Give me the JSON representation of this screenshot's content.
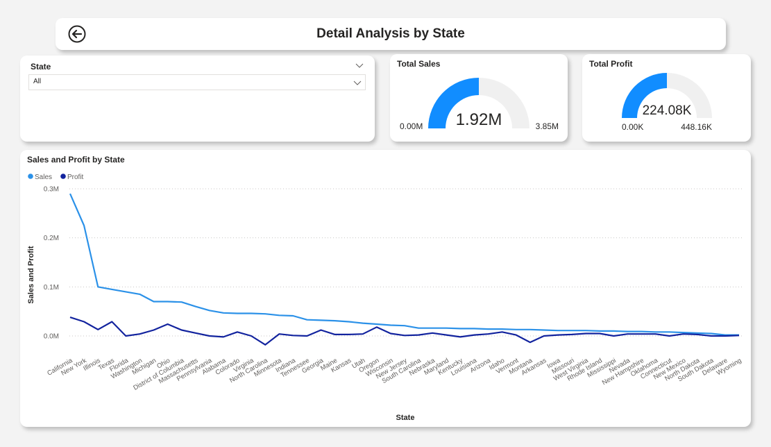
{
  "header": {
    "title": "Detail Analysis by State",
    "back_icon": "back-arrow-icon"
  },
  "slicer": {
    "label": "State",
    "selected": "All"
  },
  "kpis": {
    "sales": {
      "label": "Total Sales",
      "value": "1.92M",
      "min": "0.00M",
      "max": "3.85M",
      "fraction": 0.5,
      "color": "#118DFF"
    },
    "profit": {
      "label": "Total Profit",
      "value": "224.08K",
      "min": "0.00K",
      "max": "448.16K",
      "fraction": 0.5,
      "color": "#118DFF"
    }
  },
  "colors": {
    "sales": "#2B91E8",
    "profit": "#12239E",
    "gauge_track": "#F0F0F0"
  },
  "chart": {
    "title": "Sales and Profit by State"
  },
  "chart_data": {
    "type": "line",
    "title": "Sales and Profit by State",
    "xlabel": "State",
    "ylabel": "Sales and Profit",
    "ylim": [
      -0.02,
      0.3
    ],
    "yticks": [
      0,
      0.1,
      0.2,
      0.3
    ],
    "ytick_labels": [
      "0.0M",
      "0.1M",
      "0.2M",
      "0.3M"
    ],
    "legend_position": "top-left",
    "grid": true,
    "categories": [
      "California",
      "New York",
      "Illinois",
      "Texas",
      "Florida",
      "Washington",
      "Michigan",
      "Ohio",
      "District of Columbia",
      "Massachusetts",
      "Pennsylvania",
      "Alabama",
      "Colorado",
      "Virginia",
      "North Carolina",
      "Minnesota",
      "Indiana",
      "Tennessee",
      "Georgia",
      "Maine",
      "Kansas",
      "Utah",
      "Oregon",
      "Wisconsin",
      "New Jersey",
      "South Carolina",
      "Nebraska",
      "Maryland",
      "Kentucky",
      "Louisiana",
      "Arizona",
      "Idaho",
      "Vermont",
      "Montana",
      "Arkansas",
      "Iowa",
      "Missouri",
      "West Virginia",
      "Rhode Island",
      "Mississippi",
      "Nevada",
      "New Hampshire",
      "Oklahoma",
      "Connecticut",
      "New Mexico",
      "North Dakota",
      "South Dakota",
      "Delaware",
      "Wyoming"
    ],
    "series": [
      {
        "name": "Sales",
        "values": [
          0.29,
          0.225,
          0.1,
          0.095,
          0.09,
          0.085,
          0.07,
          0.07,
          0.069,
          0.06,
          0.052,
          0.047,
          0.046,
          0.046,
          0.045,
          0.042,
          0.041,
          0.033,
          0.032,
          0.031,
          0.029,
          0.026,
          0.024,
          0.022,
          0.021,
          0.016,
          0.016,
          0.016,
          0.015,
          0.015,
          0.014,
          0.014,
          0.013,
          0.013,
          0.012,
          0.011,
          0.011,
          0.011,
          0.01,
          0.01,
          0.009,
          0.009,
          0.008,
          0.008,
          0.007,
          0.006,
          0.005,
          0.002,
          0.002
        ]
      },
      {
        "name": "Profit",
        "values": [
          0.038,
          0.029,
          0.013,
          0.029,
          0.0,
          0.004,
          0.012,
          0.024,
          0.012,
          0.006,
          0.0,
          -0.002,
          0.008,
          0.0,
          -0.018,
          0.004,
          0.001,
          0.0,
          0.012,
          0.003,
          0.003,
          0.004,
          0.018,
          0.005,
          0.001,
          0.002,
          0.006,
          0.002,
          -0.002,
          0.002,
          0.004,
          0.008,
          0.002,
          -0.013,
          0.0,
          0.002,
          0.003,
          0.005,
          0.005,
          0.0,
          0.004,
          0.004,
          0.004,
          0.0,
          0.004,
          0.003,
          0.0,
          0.0,
          0.001
        ]
      }
    ]
  }
}
